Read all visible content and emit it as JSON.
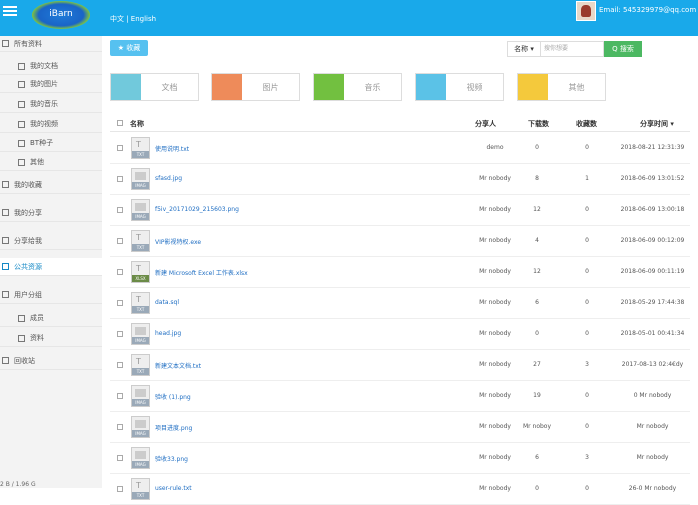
{
  "header": {
    "logo": "iBarn",
    "lang": "中文 | English",
    "email": "Email:  545329979@qq.com"
  },
  "sidebar": {
    "all_files": "所有资料",
    "docs": "我的文档",
    "images": "我的图片",
    "music": "我的音乐",
    "videos": "我的视频",
    "bt": "BT种子",
    "other": "其他",
    "favorites": "我的收藏",
    "shares": "我的分享",
    "shared_to_me": "分享给我",
    "public": "公共资源",
    "user_groups": "用户分组",
    "members": "成员",
    "data": "资料",
    "trash": "回收站",
    "storage": "2 B / 1.96 G"
  },
  "toolbar": {
    "collect": "★ 收藏",
    "sort": "名称 ▾",
    "search_placeholder": "搜你想要",
    "search_btn": "Q 搜索"
  },
  "categories": [
    {
      "label": "文档",
      "color": "#71c9dc"
    },
    {
      "label": "图片",
      "color": "#ee8b5a"
    },
    {
      "label": "音乐",
      "color": "#72c040"
    },
    {
      "label": "视频",
      "color": "#5bc2e7"
    },
    {
      "label": "其他",
      "color": "#f4c93c"
    }
  ],
  "columns": {
    "name": "名称",
    "sharer": "分享人",
    "downloads": "下载数",
    "favorites": "收藏数",
    "time": "分享时间 ▾"
  },
  "rows": [
    {
      "type": "TXT",
      "name": "使用说明.txt",
      "sharer": "demo",
      "dl": "0",
      "fav": "0",
      "time": "2018-08-21 12:31:39"
    },
    {
      "type": "IMAG",
      "name": "sfasd.jpg",
      "sharer": "Mr nobody",
      "dl": "8",
      "fav": "1",
      "time": "2018-06-09 13:01:52"
    },
    {
      "type": "IMAG",
      "name": "f5iv_20171029_215603.png",
      "sharer": "Mr nobody",
      "dl": "12",
      "fav": "0",
      "time": "2018-06-09 13:00:18"
    },
    {
      "type": "TXT",
      "name": "VIP影视特权.exe",
      "sharer": "Mr nobody",
      "dl": "4",
      "fav": "0",
      "time": "2018-06-09 00:12:09"
    },
    {
      "type": "XLSX",
      "name": "新建 Microsoft Excel 工作表.xlsx",
      "sharer": "Mr nobody",
      "dl": "12",
      "fav": "0",
      "time": "2018-06-09 00:11:19"
    },
    {
      "type": "TXT",
      "name": "data.sql",
      "sharer": "Mr nobody",
      "dl": "6",
      "fav": "0",
      "time": "2018-05-29 17:44:38"
    },
    {
      "type": "IMAG",
      "name": "head.jpg",
      "sharer": "Mr nobody",
      "dl": "0",
      "fav": "0",
      "time": "2018-05-01 00:41:34"
    },
    {
      "type": "TXT",
      "name": "新建文本文档.txt",
      "sharer": "Mr nobody",
      "dl": "27",
      "fav": "3",
      "time": "2017-08-13 02:4€dy"
    },
    {
      "type": "IMAG",
      "name": "验收 (1).png",
      "sharer": "Mr nobody",
      "dl": "19",
      "fav": "0",
      "time": "0    Mr nobody"
    },
    {
      "type": "IMAG",
      "name": "项目进度.png",
      "sharer": "Mr nobody",
      "dl": "Mr noboy",
      "fav": "0",
      "time": "Mr nobody"
    },
    {
      "type": "IMAG",
      "name": "验收33.png",
      "sharer": "Mr nobody",
      "dl": "6",
      "fav": "3",
      "time": "Mr nobody"
    },
    {
      "type": "TXT",
      "name": "user-rule.txt",
      "sharer": "Mr nobody",
      "dl": "0",
      "fav": "0",
      "time": "26-0    Mr nobody"
    }
  ]
}
